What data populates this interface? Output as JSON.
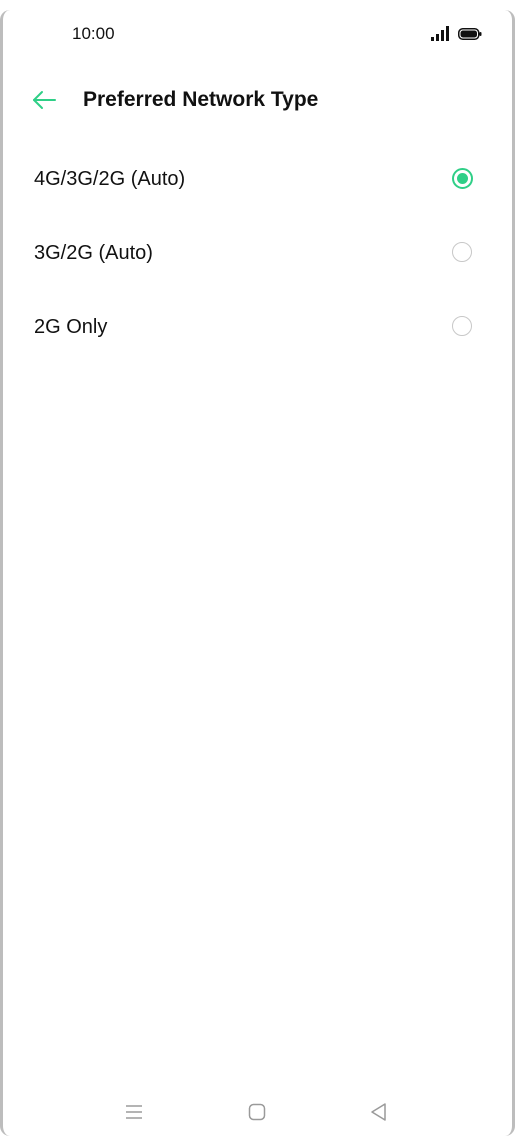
{
  "status_bar": {
    "time": "10:00",
    "icons": [
      "signal-icon",
      "battery-icon"
    ]
  },
  "header": {
    "title": "Preferred Network Type",
    "back_icon": "arrow-left-icon"
  },
  "options": [
    {
      "label": "4G/3G/2G (Auto)",
      "selected": true
    },
    {
      "label": "3G/2G (Auto)",
      "selected": false
    },
    {
      "label": "2G Only",
      "selected": false
    }
  ],
  "nav_bar": {
    "icons": [
      "menu-icon",
      "home-icon",
      "back-triangle-icon"
    ]
  },
  "colors": {
    "accent": "#2fcf87",
    "text": "#111111",
    "radio_border": "#c8c8c8",
    "nav_icon": "#9a9a9a"
  }
}
